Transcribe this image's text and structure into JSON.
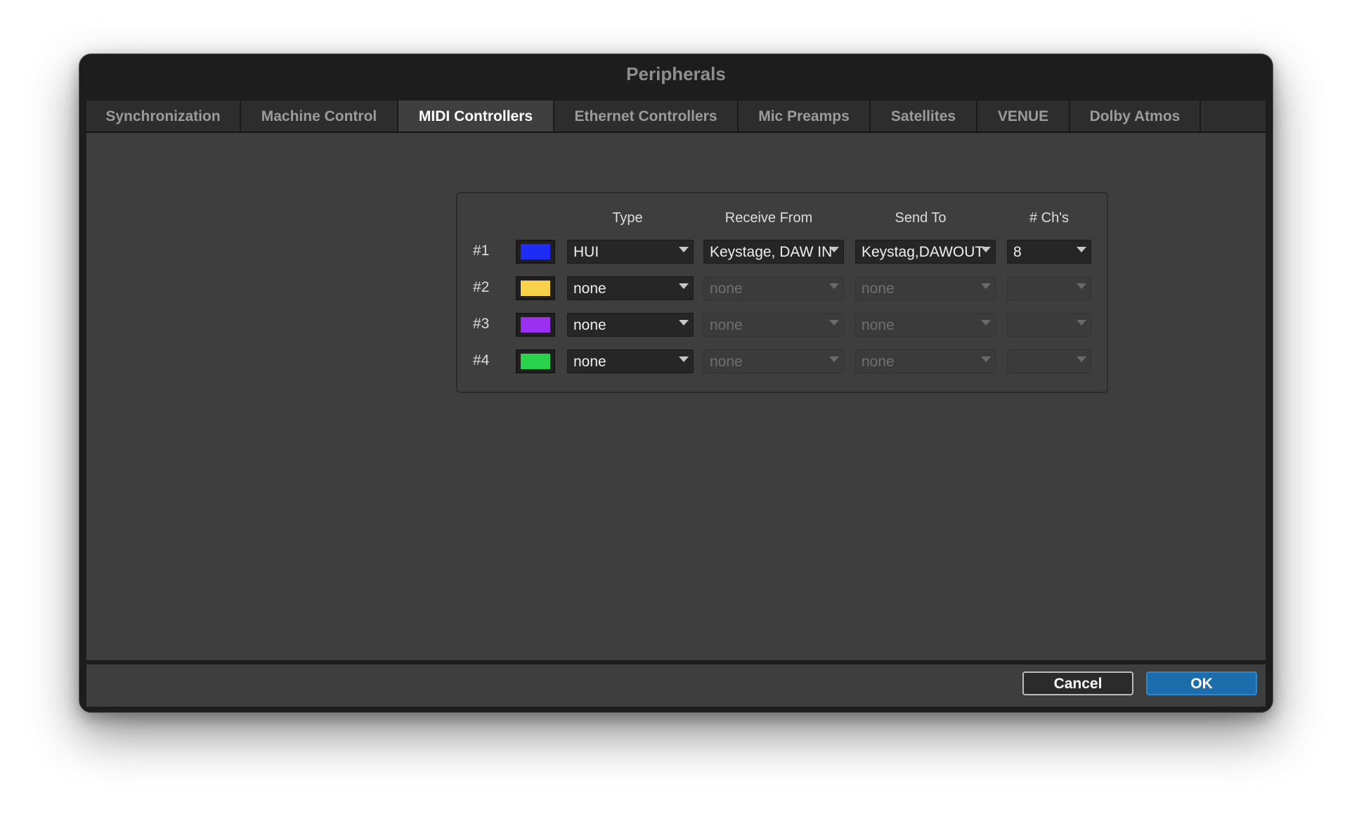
{
  "window": {
    "title": "Peripherals"
  },
  "tabs": [
    {
      "label": "Synchronization",
      "active": false
    },
    {
      "label": "Machine Control",
      "active": false
    },
    {
      "label": "MIDI Controllers",
      "active": true
    },
    {
      "label": "Ethernet Controllers",
      "active": false
    },
    {
      "label": "Mic Preamps",
      "active": false
    },
    {
      "label": "Satellites",
      "active": false
    },
    {
      "label": "VENUE",
      "active": false
    },
    {
      "label": "Dolby Atmos",
      "active": false
    }
  ],
  "midi": {
    "headers": {
      "type": "Type",
      "receive": "Receive From",
      "send": "Send To",
      "channels": "# Ch's"
    },
    "rows": [
      {
        "label": "#1",
        "color": "#1f2cf5",
        "type": "HUI",
        "receive": "Keystage, DAW IN",
        "send": "Keystag,DAWOUT",
        "channels": "8",
        "enabled": true
      },
      {
        "label": "#2",
        "color": "#f7d24a",
        "type": "none",
        "receive": "none",
        "send": "none",
        "channels": "",
        "enabled": false
      },
      {
        "label": "#3",
        "color": "#9b30f2",
        "type": "none",
        "receive": "none",
        "send": "none",
        "channels": "",
        "enabled": false
      },
      {
        "label": "#4",
        "color": "#2bd34d",
        "type": "none",
        "receive": "none",
        "send": "none",
        "channels": "",
        "enabled": false
      }
    ]
  },
  "buttons": {
    "cancel": "Cancel",
    "ok": "OK"
  }
}
